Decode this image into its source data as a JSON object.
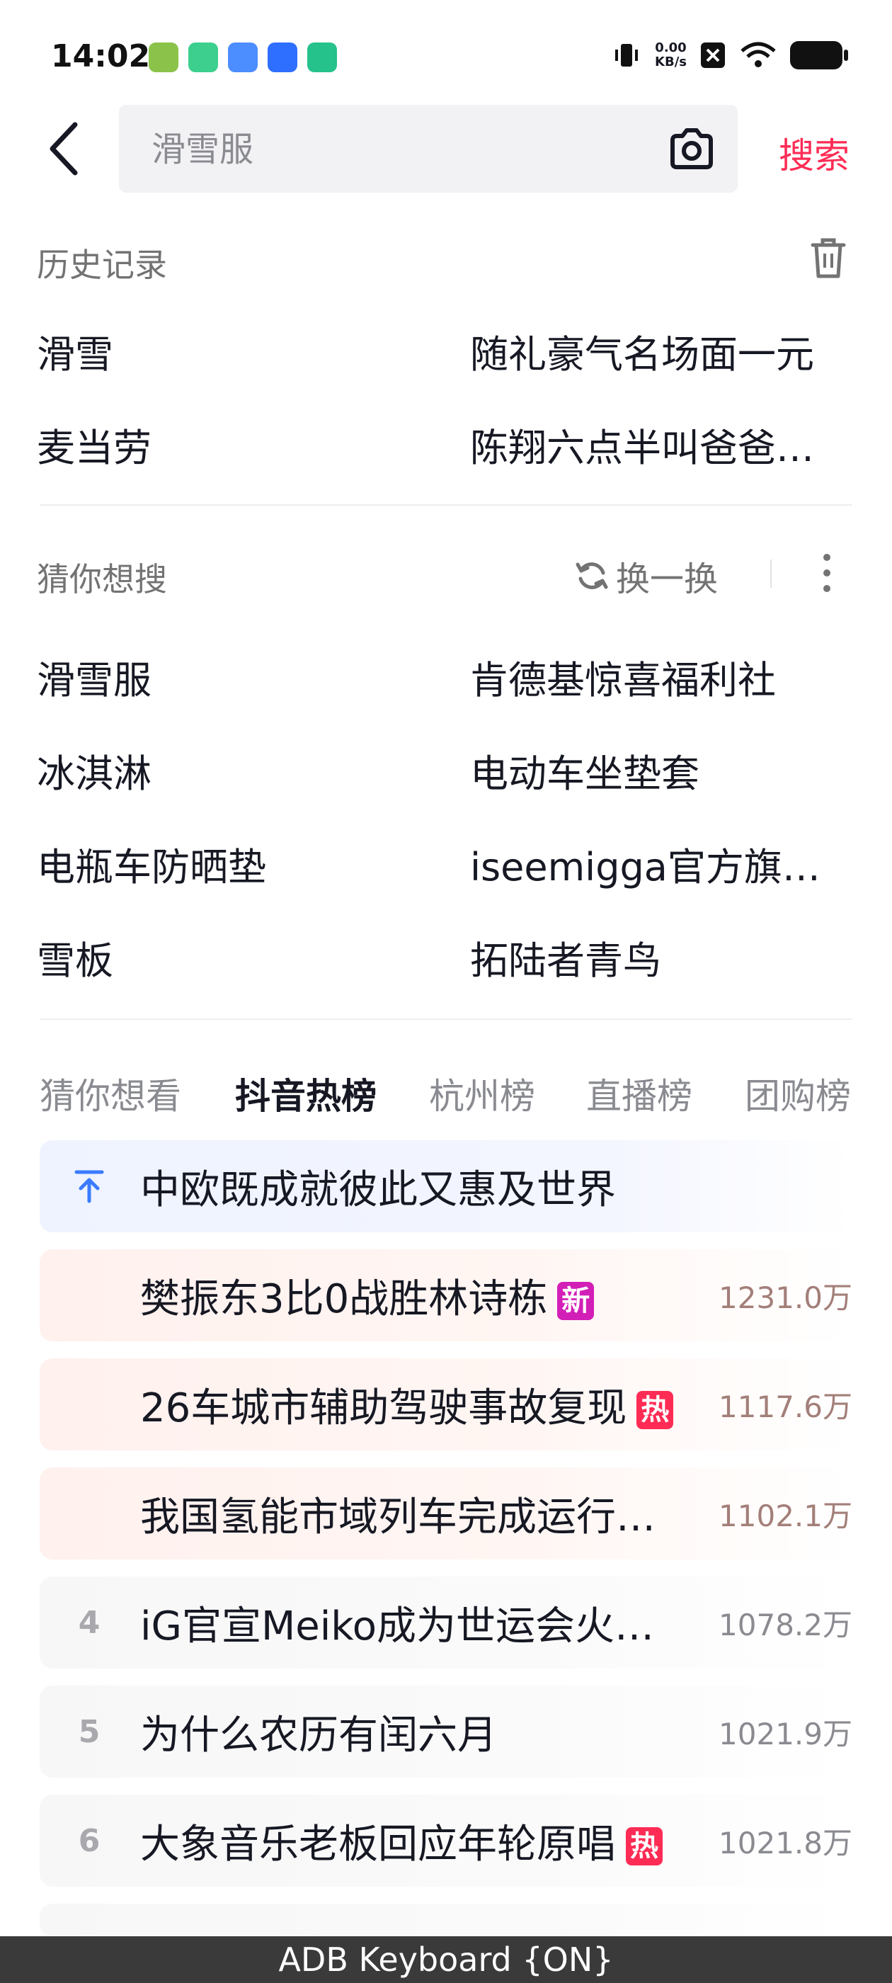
{
  "status_bar": {
    "time": "14:02",
    "net_speed_value": "0.00",
    "net_speed_unit": "KB/s",
    "app_icon_colors": [
      "#8bc34a",
      "#3ccf8e",
      "#4c8dff",
      "#2f6fff",
      "#25c28b"
    ]
  },
  "search": {
    "placeholder": "滑雪服",
    "button_label": "搜索"
  },
  "history": {
    "title": "历史记录",
    "items": [
      "滑雪",
      "随礼豪气名场面一元",
      "麦当劳",
      "陈翔六点半叫爸爸…"
    ]
  },
  "guess": {
    "title": "猜你想搜",
    "refresh_label": "换一换",
    "items": [
      "滑雪服",
      "肯德基惊喜福利社",
      "冰淇淋",
      "电动车坐垫套",
      "电瓶车防晒垫",
      "iseemigga官方旗…",
      "雪板",
      "拓陆者青鸟"
    ]
  },
  "tabs": [
    "猜你想看",
    "抖音热榜",
    "杭州榜",
    "直播榜",
    "团购榜"
  ],
  "active_tab": "抖音热榜",
  "hot_list": [
    {
      "rank": "",
      "title": "中欧既成就彼此又惠及世界",
      "badge": "",
      "heat": "",
      "pinned": true
    },
    {
      "rank": "",
      "title": "樊振东3比0战胜林诗栋",
      "badge": "新",
      "badge_color": "#d21fb7",
      "heat": "1231.0万"
    },
    {
      "rank": "",
      "title": "26车城市辅助驾驶事故复现",
      "badge": "热",
      "badge_color": "#fe2c55",
      "heat": "1117.6万"
    },
    {
      "rank": "",
      "title": "我国氢能市域列车完成运行…",
      "badge": "",
      "heat": "1102.1万"
    },
    {
      "rank": "4",
      "title": "iG官宣Meiko成为世运会火…",
      "badge": "",
      "heat": "1078.2万"
    },
    {
      "rank": "5",
      "title": "为什么农历有闰六月",
      "badge": "",
      "heat": "1021.9万"
    },
    {
      "rank": "6",
      "title": "大象音乐老板回应年轮原唱",
      "badge": "热",
      "badge_color": "#fe2c55",
      "heat": "1021.8万"
    }
  ],
  "adb": {
    "label": "ADB Keyboard {ON}"
  }
}
